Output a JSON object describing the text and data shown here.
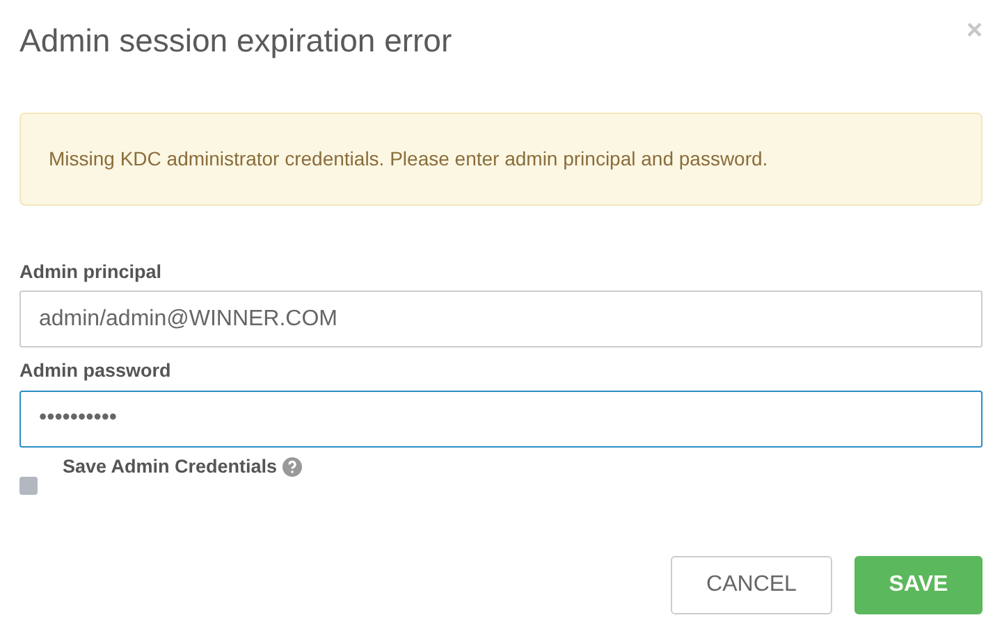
{
  "dialog": {
    "title": "Admin session expiration error",
    "close_glyph": "×"
  },
  "alert": {
    "message": "Missing KDC administrator credentials. Please enter admin principal and password."
  },
  "fields": [
    {
      "label": "Admin principal",
      "value": "admin/admin@WINNER.COM",
      "focused": false
    },
    {
      "label": "Admin password",
      "value": "••••••••••",
      "focused": true
    }
  ],
  "save_credentials": {
    "label": "Save Admin Credentials",
    "checked": false
  },
  "buttons": [
    {
      "label": "CANCEL",
      "kind": "secondary"
    },
    {
      "label": "SAVE",
      "kind": "primary"
    }
  ]
}
